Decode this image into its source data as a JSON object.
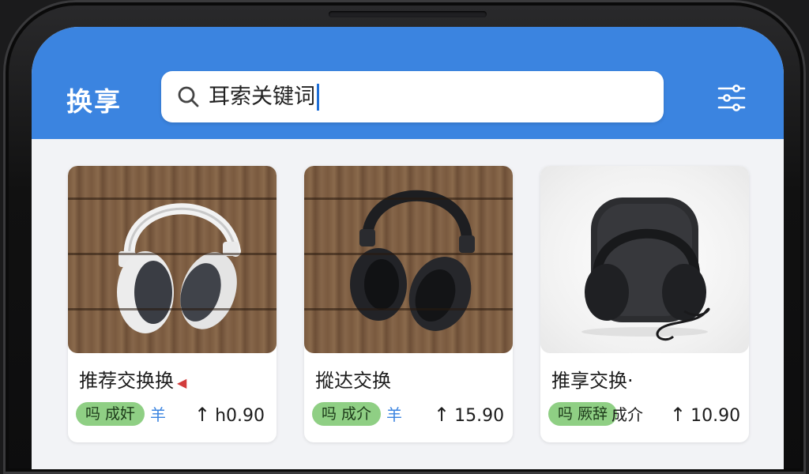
{
  "header": {
    "app_title": "换享",
    "search_value": "耳索关键词",
    "background_color": "#3b84e0"
  },
  "icons": {
    "search": "search-icon",
    "filter": "sliders-icon",
    "price_arrow": "arrow-up-icon"
  },
  "products": [
    {
      "title": "推荐交换换",
      "title_mark": "◀",
      "badge": "吗 成奸",
      "tag": "羊",
      "price_arrow": "↑",
      "price": "h0.90",
      "image": "white-headphones-on-wood"
    },
    {
      "title": "摐达交换",
      "badge": "吗 成介",
      "tag": "羊",
      "price_arrow": "↑",
      "price": "15.90",
      "image": "black-headphones-on-wood"
    },
    {
      "title": "推享交换·",
      "badge": "吗 厥辞",
      "tag": "成介",
      "price_arrow": "↑",
      "price": "10.90",
      "image": "black-headphones-with-case"
    }
  ],
  "colors": {
    "badge_green": "#8fcf84",
    "tag_blue": "#3b84e0",
    "caret_blue": "#1f6fd6"
  }
}
